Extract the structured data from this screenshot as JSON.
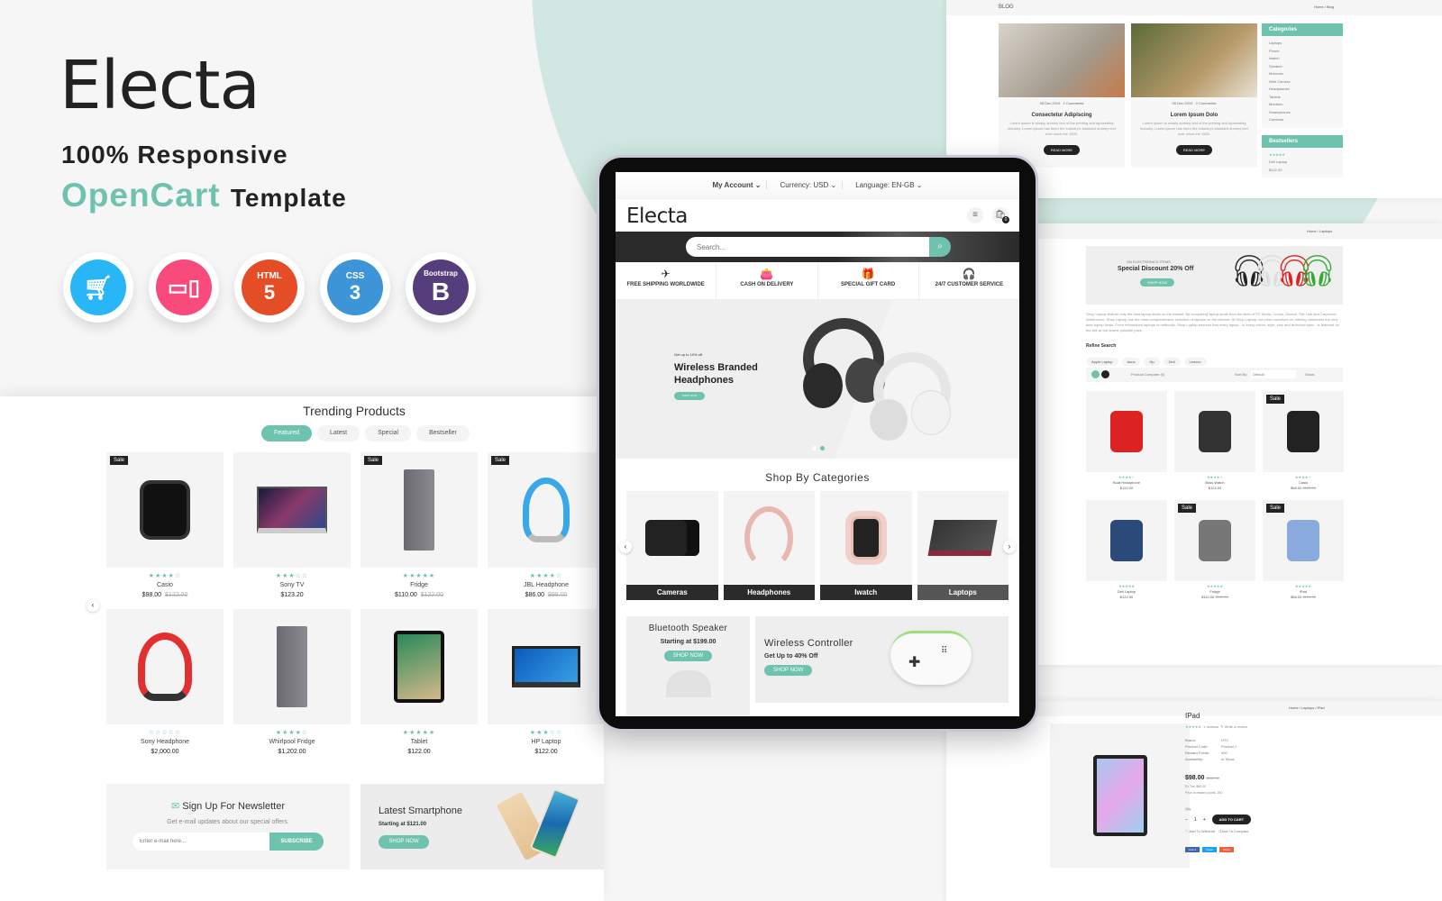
{
  "hero": {
    "brand": "Electa",
    "line1": "100% Responsive",
    "line2_accent": "OpenCart",
    "line2_rest": "Template",
    "badges": [
      {
        "name": "opencart",
        "label": "",
        "color": "#29b6f6"
      },
      {
        "name": "responsive",
        "label": "",
        "color": "#f94a7c"
      },
      {
        "name": "html5",
        "label": "HTML",
        "color": "#e44d26"
      },
      {
        "name": "css3",
        "label": "CSS",
        "color": "#3d95d8"
      },
      {
        "name": "bootstrap",
        "label": "Bootstrap",
        "color": "#563d7c"
      }
    ]
  },
  "colors": {
    "accent": "#6fc2ae",
    "dark": "#222222"
  },
  "tablet": {
    "topbar": {
      "account": "My Account ⌄",
      "currency": "Currency: USD ⌄",
      "language": "Language: EN-GB ⌄"
    },
    "logo": "Electa",
    "cart_count": "0",
    "search_placeholder": "Search...",
    "services": [
      {
        "icon": "✈",
        "label": "FREE SHIPPING WORLDWIDE"
      },
      {
        "icon": "👛",
        "label": "CASH ON DELIVERY"
      },
      {
        "icon": "🎁",
        "label": "SPECIAL GIFT CARD"
      },
      {
        "icon": "🎧",
        "label": "24/7 CUSTOMER SERVICE"
      }
    ],
    "slider": {
      "pre": "Get up to 10% off",
      "title": "Wireless Branded Headphones",
      "button": "SHOP NOW"
    },
    "categories_title": "Shop By Categories",
    "categories": [
      "Cameras",
      "Headphones",
      "Iwatch",
      "Laptops"
    ],
    "promo1": {
      "title": "Bluetooth Speaker",
      "sub": "Starting at $199.00",
      "button": "SHOP NOW"
    },
    "promo2": {
      "title": "Wireless Controller",
      "sub": "Get Up to 40% Off",
      "button": "SHOP NOW"
    }
  },
  "trending": {
    "title": "Trending Products",
    "tabs": [
      "Featured",
      "Latest",
      "Special",
      "Bestseller"
    ],
    "active_tab": "Featured",
    "products": [
      {
        "name": "Casio",
        "stars": "★★★★☆",
        "price": "$98.00",
        "old": "$122.00",
        "sale": "Sale"
      },
      {
        "name": "Sony TV",
        "stars": "★★★☆☆",
        "price": "$123.20",
        "old": "",
        "sale": ""
      },
      {
        "name": "Fridge",
        "stars": "★★★★★",
        "price": "$110.00",
        "old": "$122.00",
        "sale": "Sale"
      },
      {
        "name": "JBL Headphone",
        "stars": "★★★★☆",
        "price": "$86.00",
        "old": "$98.00",
        "sale": "Sale"
      },
      {
        "name": "Sony Headphone",
        "stars": "☆☆☆☆☆",
        "price": "$2,000.00",
        "old": "",
        "sale": ""
      },
      {
        "name": "Whirlpool Fridge",
        "stars": "★★★★☆",
        "price": "$1,202.00",
        "old": "",
        "sale": ""
      },
      {
        "name": "Tablet",
        "stars": "★★★★★",
        "price": "$122.00",
        "old": "",
        "sale": ""
      },
      {
        "name": "HP Laptop",
        "stars": "★★★☆☆",
        "price": "$122.00",
        "old": "",
        "sale": ""
      }
    ],
    "newsletter": {
      "title": "Sign Up For Newsletter",
      "sub": "Get e-mail updates about our special offers.",
      "placeholder": "Enter e-mail here...",
      "button": "SUBSCRIBE"
    },
    "smartphone": {
      "title": "Latest Smartphone",
      "sub": "Starting at $121.00",
      "button": "SHOP NOW"
    }
  },
  "blog": {
    "crumb_left": "BLOG",
    "crumb_right": "Home / Blog",
    "posts": [
      {
        "date": "05 Dec 2019",
        "comments": "2 Comments",
        "title": "Consectetur Adipiscing",
        "text": "Lorem ipsum is simply dummy text of the printing and typesetting industry. Lorem ipsum has been the industry's standard dummy text ever since the 1500.",
        "button": "READ MORE"
      },
      {
        "date": "05 Dec 2019",
        "comments": "2 Comments",
        "title": "Lorem Ipsum Dolo",
        "text": "Lorem ipsum is simply dummy text of the printing and typesetting industry. Lorem ipsum has been the industry's standard dummy text ever since the 1500.",
        "button": "READ MORE"
      }
    ],
    "categories_title": "Categories",
    "categories": [
      "Laptops",
      "Phone",
      "Iwatch",
      "Speaker",
      "Motorola",
      "Web Camera",
      "Headphones",
      "Tablets",
      "Monitors",
      "Smartphones",
      "Cameras"
    ],
    "bestsellers_title": "Bestsellers",
    "bestseller": {
      "name": "Dell Laptop",
      "price": "$122.00",
      "stars": "★★★★★"
    }
  },
  "category_page": {
    "crumb": "Home / Laptops",
    "banner": {
      "pre": "ON ELECTRONICS ITEMS",
      "title": "Special Discount 20% Off",
      "button": "SHOP NOW"
    },
    "description": "Shop Laptop feature only the best laptop deals on the market. By comparing laptop deals from the likes of PC World, Currys, Dixons, The Link and Carphone Warehouse, Shop Laptop has the most comprehensive selection of laptops on the internet. At Shop Laptop, we pride ourselves on offering customers the very best laptop deals. From refurbished laptops to netbooks, Shop Laptop ensures that every laptop - in every colour, style, size and technical spec - is featured on the site at the lowest possible price.",
    "refine_title": "Refine Search",
    "refine": [
      "Apple Laptop",
      "Asus",
      "Hp",
      "Dell",
      "Lenovo"
    ],
    "compare": "Product Compare (0)",
    "sort_label": "Sort By:",
    "sort_value": "Default",
    "show_label": "Show:",
    "products": [
      {
        "name": "Boat Headphone",
        "price": "$122.00",
        "old": "",
        "sale": "",
        "stars": "★★★★☆"
      },
      {
        "name": "Boss Watch",
        "price": "$122.00",
        "old": "",
        "sale": "",
        "stars": "★★★★☆"
      },
      {
        "name": "Casio",
        "price": "$98.00",
        "old": "$122.00",
        "sale": "Sale",
        "stars": "★★★★☆"
      },
      {
        "name": "Dell Laptop",
        "price": "$122.00",
        "old": "",
        "sale": "",
        "stars": "★★★★★"
      },
      {
        "name": "Fridge",
        "price": "$110.00",
        "old": "$122.00",
        "sale": "Sale",
        "stars": "★★★★★"
      },
      {
        "name": "iPad",
        "price": "$98.00",
        "old": "$122.00",
        "sale": "Sale",
        "stars": "★★★★★"
      }
    ]
  },
  "product_page": {
    "crumb": "Home / Laptops / iPad",
    "title": "IPad",
    "reviews": "1 reviews",
    "write_review": "Write a review",
    "specs": [
      [
        "Brand:",
        "HTC"
      ],
      [
        "Product Code:",
        "Product 1"
      ],
      [
        "Reward Points:",
        "400"
      ],
      [
        "Availability:",
        "In Stock"
      ]
    ],
    "price": "$98.00",
    "old_price": "$122.00",
    "ex_tax": "Ex Tax: $80.00",
    "reward": "Price in reward points: 200",
    "qty_label": "Qty",
    "qty": "1",
    "add_to_cart": "ADD TO CART",
    "wishlist": "Add To WishList",
    "compare": "Add To Compare",
    "share": [
      "Like 0",
      "Tweet",
      "Share"
    ]
  }
}
